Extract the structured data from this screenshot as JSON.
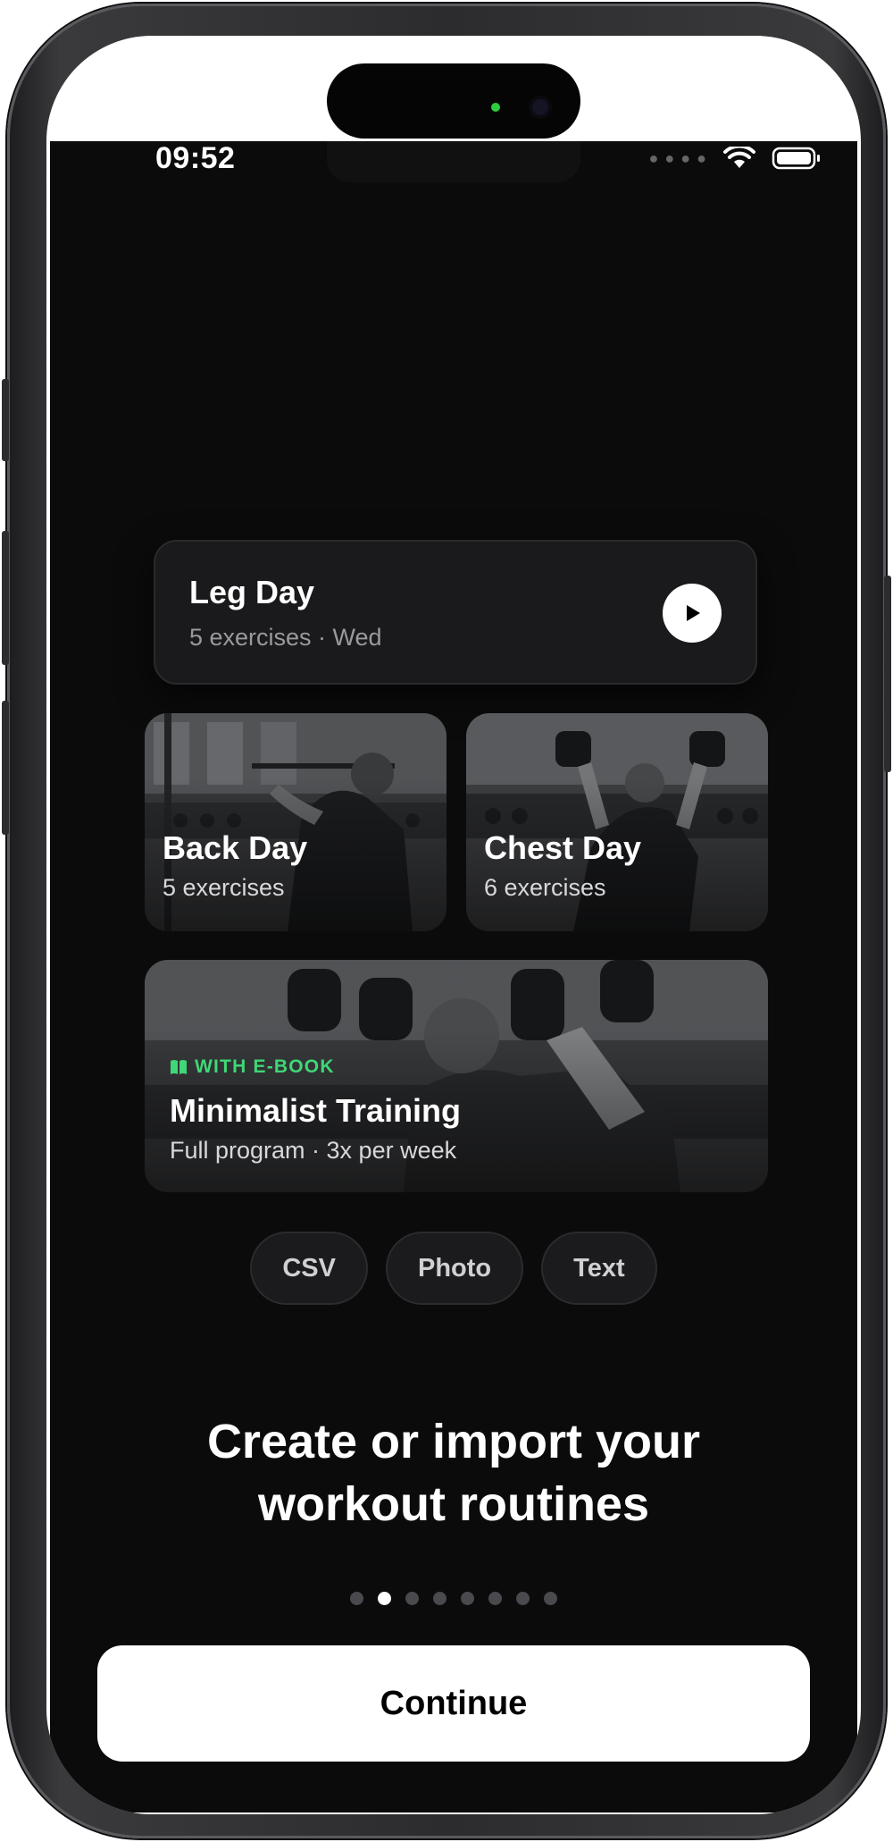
{
  "status_bar": {
    "time": "09:52",
    "signal_icon": "signal-dots-icon",
    "wifi_icon": "wifi-icon",
    "battery_icon": "battery-icon"
  },
  "routine_card": {
    "title": "Leg Day",
    "subtitle": "5 exercises · Wed",
    "action_icon": "play-icon"
  },
  "workout_cards": [
    {
      "title": "Back Day",
      "subtitle": "5 exercises"
    },
    {
      "title": "Chest Day",
      "subtitle": "6 exercises"
    }
  ],
  "program_card": {
    "badge": "WITH E-BOOK",
    "badge_icon": "book-icon",
    "badge_color": "#3fd777",
    "title": "Minimalist Training",
    "subtitle": "Full program · 3x per week"
  },
  "import_options": [
    "CSV",
    "Photo",
    "Text"
  ],
  "headline": {
    "line1": "Create or import your",
    "line2": "workout routines"
  },
  "pagination": {
    "total": 8,
    "active_index": 1
  },
  "continue_button": {
    "label": "Continue"
  },
  "colors": {
    "background": "#0b0b0c",
    "card": "#1a1a1c",
    "accent": "#3fd777",
    "button": "#ffffff"
  }
}
